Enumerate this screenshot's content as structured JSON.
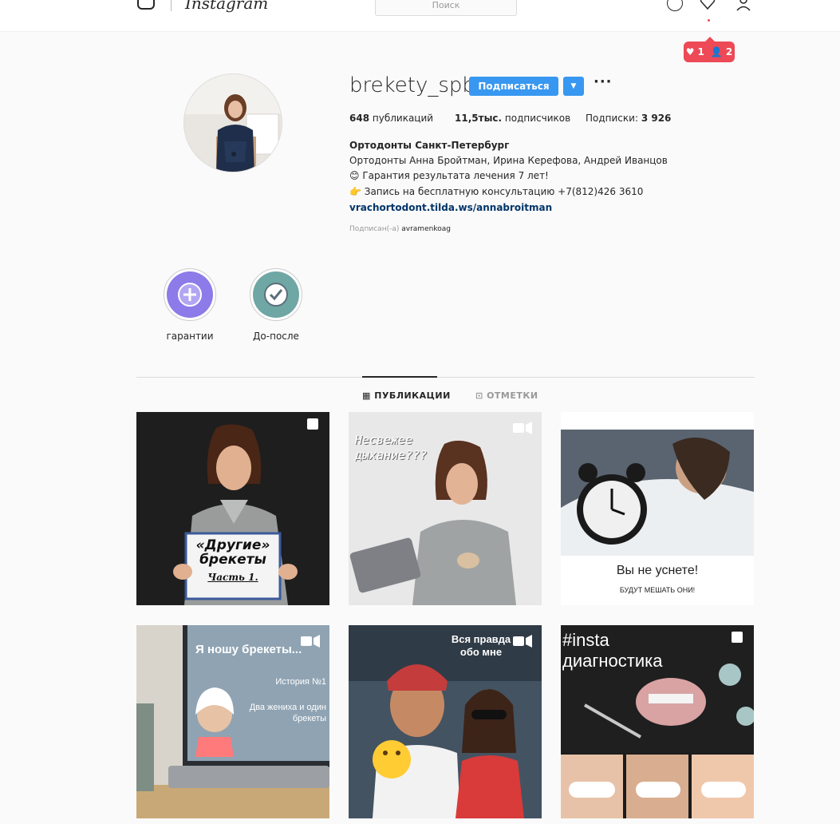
{
  "header": {
    "logo_text": "Instagram",
    "search_placeholder": "Поиск",
    "notifications": {
      "likes": "1",
      "followers": "2"
    }
  },
  "profile": {
    "username": "brekety_spb",
    "follow_label": "Подписаться",
    "more_label": "···",
    "stats": {
      "posts_count": "648",
      "posts_label": "публикаций",
      "followers_count": "11,5тыс.",
      "followers_label": "подписчиков",
      "following_label": "Подписки:",
      "following_count": "3 926"
    },
    "bio": {
      "full_name": "Ортодонты Санкт-Петербург",
      "line1": "Ортодонты Анна Бройтман, Ирина Керефова, Андрей Иванцов",
      "line2": "😊 Гарантия результата лечения 7 лет!",
      "line3": "👉 Запись на бесплатную консультацию +7(812)426 3610",
      "link": "vrachortodont.tilda.ws/annabroitman"
    },
    "followed_by_prefix": "Подписан(-а)",
    "followed_by_user": "avramenkoag"
  },
  "highlights": [
    {
      "label": "гарантии",
      "icon": "plus-circle-icon",
      "color": "#8c7be8"
    },
    {
      "label": "До-после",
      "icon": "check-circle-icon",
      "color": "#6fa7a5"
    }
  ],
  "tabs": [
    {
      "label": "ПУБЛИКАЦИИ",
      "icon": "grid-icon",
      "active": true
    },
    {
      "label": "ОТМЕТКИ",
      "icon": "tag-icon",
      "active": false
    }
  ],
  "posts": [
    {
      "icon": "carousel-icon",
      "sign_line1": "«Другие»",
      "sign_line2": "брекеты",
      "sign_line3": "Часть 1."
    },
    {
      "icon": "video-icon",
      "caption_line1": "Несвежее",
      "caption_line2": "дыхание???"
    },
    {
      "icon": "",
      "caption_title": "Вы не уснете!",
      "caption_sub": "БУДУТ МЕШАТЬ ОНИ!"
    },
    {
      "icon": "video-icon",
      "caption_title": "Я ношу брекеты...",
      "caption_line1": "История №1",
      "caption_line2": "Два жениха и один",
      "caption_line3": "брекеты"
    },
    {
      "icon": "video-icon",
      "caption_line1": "Вся правда",
      "caption_line2": "обо мне"
    },
    {
      "icon": "carousel-icon",
      "caption_line1": "#insta",
      "caption_line2": "диагностика"
    }
  ],
  "colors": {
    "accent": "#3897f0",
    "notification": "#ed4956",
    "link": "#003569"
  }
}
